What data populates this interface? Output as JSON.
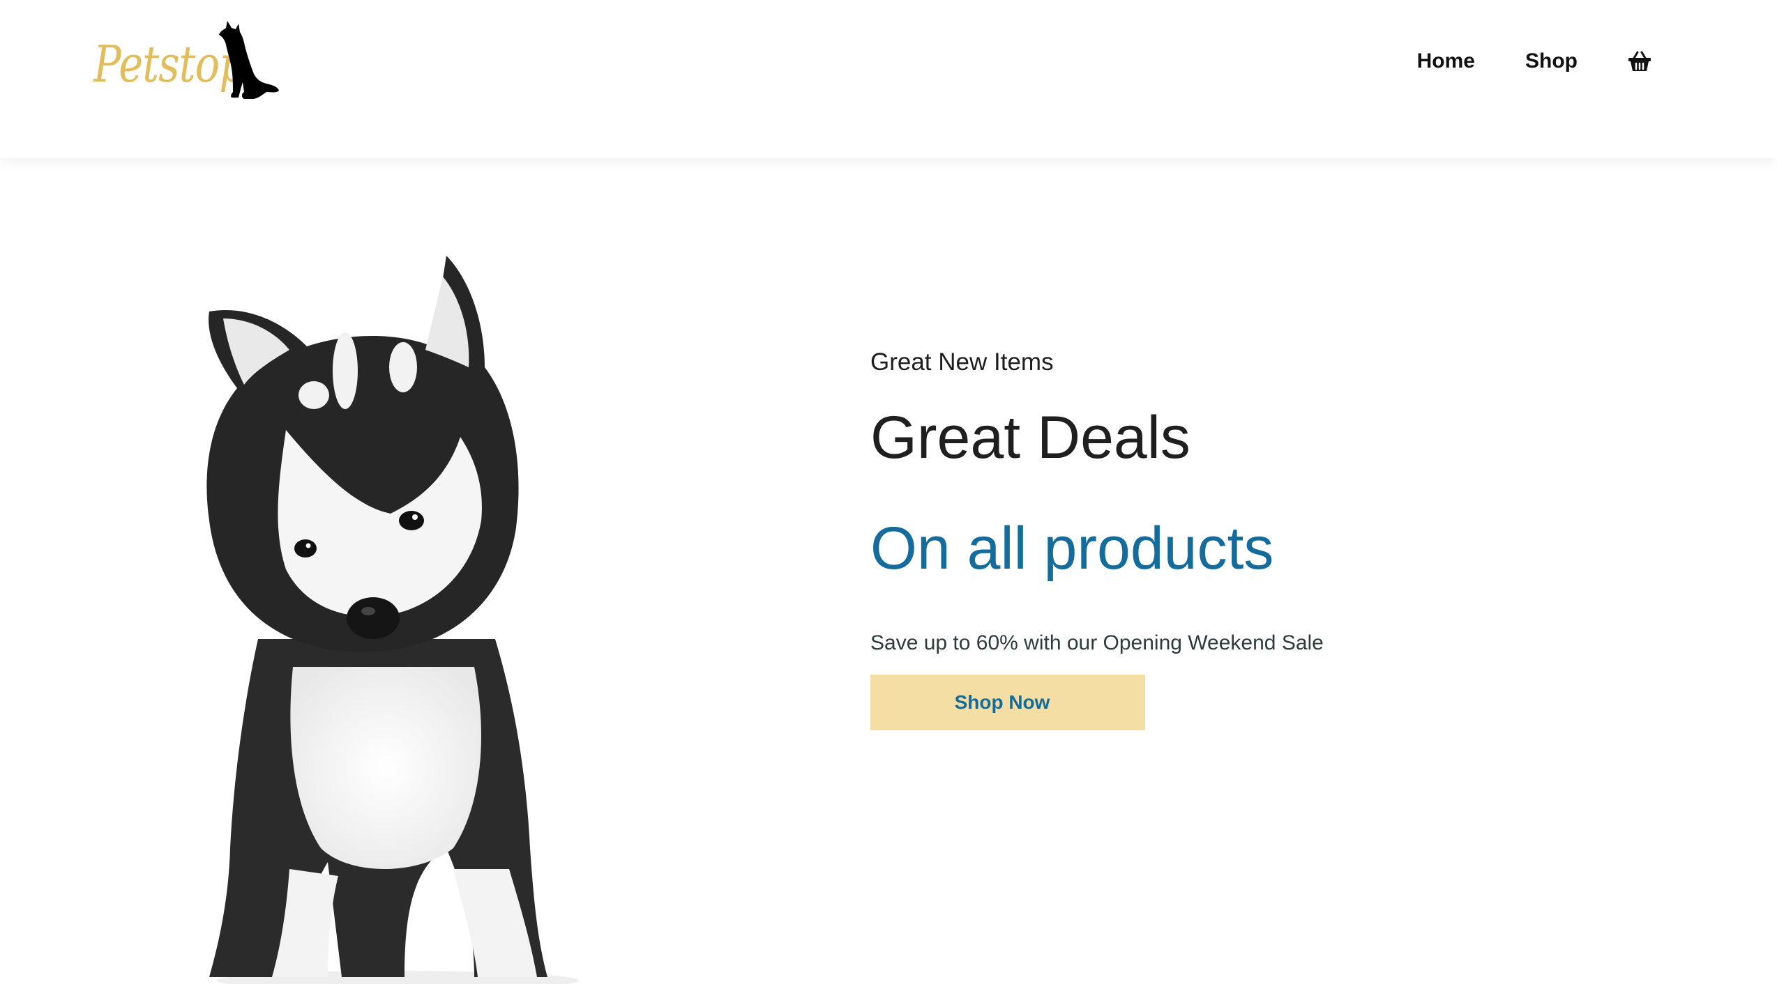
{
  "brand": {
    "logo_text": "Petstop",
    "logo_color": "#e2bd5b",
    "logo_icon": "sitting-dog-silhouette"
  },
  "nav": {
    "items": [
      {
        "label": "Home"
      },
      {
        "label": "Shop"
      }
    ],
    "cart_icon": "shopping-basket-icon"
  },
  "hero": {
    "eyebrow": "Great New Items",
    "title": "Great Deals",
    "subtitle": "On all products",
    "description": "Save up to 60% with our Opening Weekend Sale",
    "cta_label": "Shop Now",
    "image": "husky-puppy",
    "accent_color": "#136c9b",
    "cta_background": "#f4dea4"
  }
}
